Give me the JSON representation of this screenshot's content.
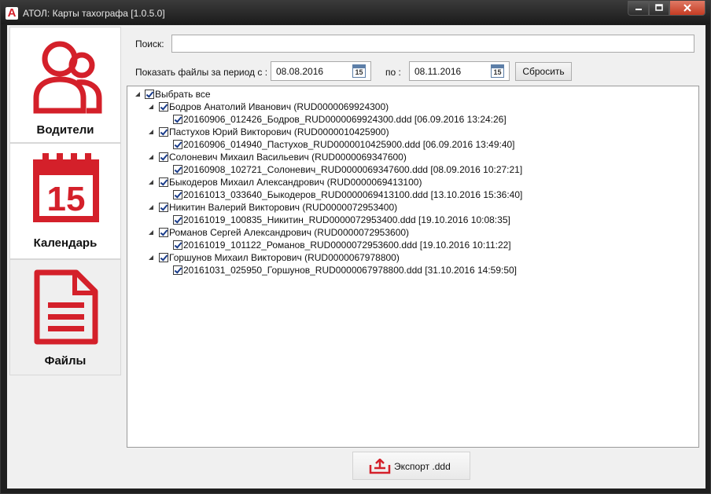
{
  "window": {
    "title": "АТОЛ: Карты тахографа [1.0.5.0]",
    "icon": "atol-logo-icon",
    "logo_letter": "A"
  },
  "sidebar": {
    "items": [
      {
        "label": "Водители",
        "icon": "drivers-icon"
      },
      {
        "label": "Календарь",
        "icon": "calendar-icon",
        "icon_text": "15"
      },
      {
        "label": "Файлы",
        "icon": "files-icon"
      }
    ],
    "active": "Файлы"
  },
  "search": {
    "label": "Поиск:",
    "value": ""
  },
  "period": {
    "label": "Показать файлы за период с :",
    "from": "08.08.2016",
    "to_label": "по :",
    "to": "08.11.2016",
    "calendar_icon_text": "15",
    "reset_label": "Сбросить"
  },
  "tree": {
    "select_all": "Выбрать все",
    "drivers": [
      {
        "name": "Бодров Анатолий Иванович (RUD0000069924300)",
        "files": [
          "20160906_012426_Бодров_RUD0000069924300.ddd [06.09.2016 13:24:26]"
        ]
      },
      {
        "name": "Пастухов Юрий Викторович (RUD0000010425900)",
        "files": [
          "20160906_014940_Пастухов_RUD0000010425900.ddd [06.09.2016 13:49:40]"
        ]
      },
      {
        "name": "Солоневич Михаил Васильевич (RUD0000069347600)",
        "files": [
          "20160908_102721_Солоневич_RUD0000069347600.ddd [08.09.2016 10:27:21]"
        ]
      },
      {
        "name": "Быкодеров Михаил Александрович (RUD0000069413100)",
        "files": [
          "20161013_033640_Быкодеров_RUD0000069413100.ddd [13.10.2016 15:36:40]"
        ]
      },
      {
        "name": "Никитин Валерий Викторович (RUD0000072953400)",
        "files": [
          "20161019_100835_Никитин_RUD0000072953400.ddd [19.10.2016 10:08:35]"
        ]
      },
      {
        "name": "Романов Сергей Александрович (RUD0000072953600)",
        "files": [
          "20161019_101122_Романов_RUD0000072953600.ddd [19.10.2016 10:11:22]"
        ]
      },
      {
        "name": "Горшунов Михаил Викторович (RUD0000067978800)",
        "files": [
          "20161031_025950_Горшунов_RUD0000067978800.ddd [31.10.2016 14:59:50]"
        ]
      }
    ]
  },
  "export": {
    "label": "Экспорт .ddd",
    "icon": "export-icon"
  },
  "colors": {
    "accent": "#d4202a",
    "calendar_icon": "#5d7fa8"
  }
}
